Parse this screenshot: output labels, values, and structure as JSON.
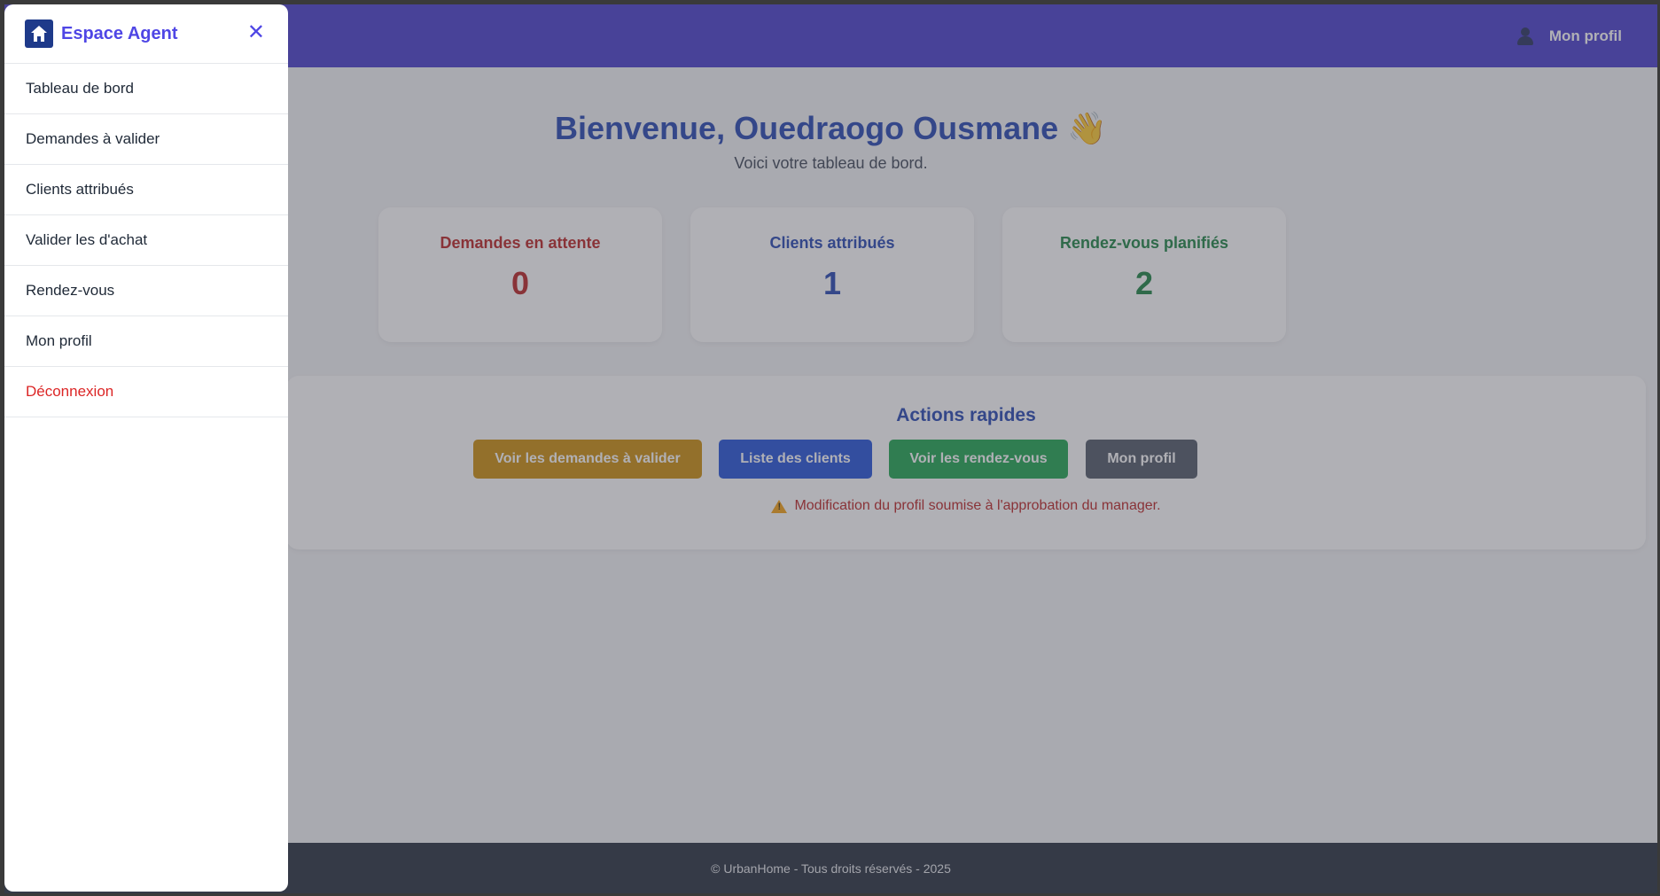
{
  "topbar": {
    "profile_label": "Mon profil",
    "profile_icon": "user-icon"
  },
  "main": {
    "welcome_title": "Bienvenue, Ouedraogo Ousmane 👋",
    "welcome_subtitle": "Voici votre tableau de bord.",
    "stats": [
      {
        "label": "Demandes en attente",
        "value": "0",
        "color": "#b91c1c"
      },
      {
        "label": "Clients attribués",
        "value": "1",
        "color": "#1e40af"
      },
      {
        "label": "Rendez-vous planifiés",
        "value": "2",
        "color": "#15803d"
      }
    ],
    "quick_actions": {
      "title": "Actions rapides",
      "buttons": [
        {
          "label": "Voir les demandes à valider",
          "color": "#ca8a04"
        },
        {
          "label": "Liste des clients",
          "color": "#1d4ed8"
        },
        {
          "label": "Voir les rendez-vous",
          "color": "#16a34a"
        },
        {
          "label": "Mon profil",
          "color": "#4b5563"
        }
      ],
      "warning": "Modification du profil soumise à l'approbation du manager.",
      "warning_icon": "warning-icon"
    }
  },
  "footer": {
    "text": "© UrbanHome - Tous droits réservés - 2025"
  },
  "sidebar": {
    "title": "Espace Agent",
    "close_symbol": "✕",
    "items": [
      {
        "label": "Tableau de bord"
      },
      {
        "label": "Demandes à valider"
      },
      {
        "label": "Clients attribués"
      },
      {
        "label": "Valider les d'achat"
      },
      {
        "label": "Rendez-vous"
      },
      {
        "label": "Mon profil"
      },
      {
        "label": "Déconnexion"
      }
    ]
  },
  "colors": {
    "primary": "#4338ca",
    "brand": "#4f46e5",
    "danger": "#dc2626"
  }
}
